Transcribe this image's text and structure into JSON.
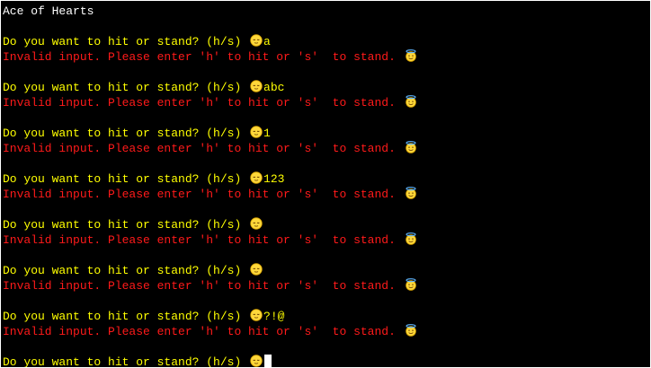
{
  "window_title": "Ace of Hearts",
  "prompt_text": "Do you want to hit or stand? (h/s) ",
  "error_text": "Invalid input. Please enter 'h' to hit or 's'  to stand. ",
  "prompt_icon": "relieved-face-icon",
  "error_icon": "halo-smiling-face-icon",
  "colors": {
    "background": "#000000",
    "title": "#ffffff",
    "prompt": "#ffff00",
    "error": "#ff1a1a"
  },
  "entries": [
    {
      "input": "a"
    },
    {
      "input": "abc"
    },
    {
      "input": "1"
    },
    {
      "input": "123"
    },
    {
      "input": ""
    },
    {
      "input": ""
    },
    {
      "input": "?!@"
    }
  ],
  "final_input": ""
}
